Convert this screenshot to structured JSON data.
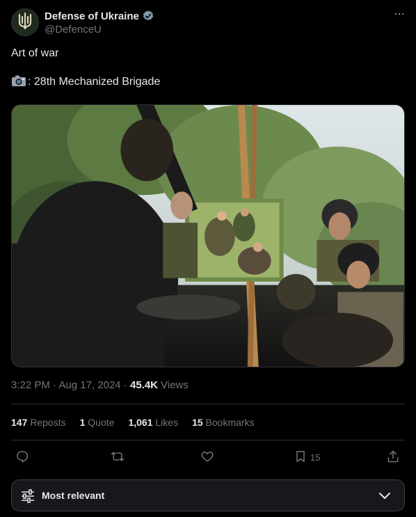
{
  "author": {
    "name": "Defense of Ukraine",
    "handle": "@DefenceU",
    "avatar_icon": "trident-icon",
    "verified": true
  },
  "tweet": {
    "line1": "Art of war",
    "line2": ": 28th Mechanized Brigade",
    "camera_icon": "camera-icon"
  },
  "media": {
    "description_icon": "photo-soldier-painting-portrait"
  },
  "meta": {
    "time": "3:22 PM",
    "sep1": " · ",
    "date": "Aug 17, 2024",
    "sep2": " · ",
    "views_count": "45.4K",
    "views_label": " Views"
  },
  "stats": {
    "reposts_count": "147",
    "reposts_label": "Reposts",
    "quotes_count": "1",
    "quotes_label": "Quote",
    "likes_count": "1,061",
    "likes_label": "Likes",
    "bookmarks_count": "15",
    "bookmarks_label": "Bookmarks"
  },
  "actions": {
    "bookmark_count": "15"
  },
  "sort": {
    "label": "Most relevant"
  },
  "colors": {
    "background": "#000000",
    "text": "#e7e9ea",
    "muted": "#71767b",
    "border": "#2f3336",
    "verified": "#829aab"
  }
}
